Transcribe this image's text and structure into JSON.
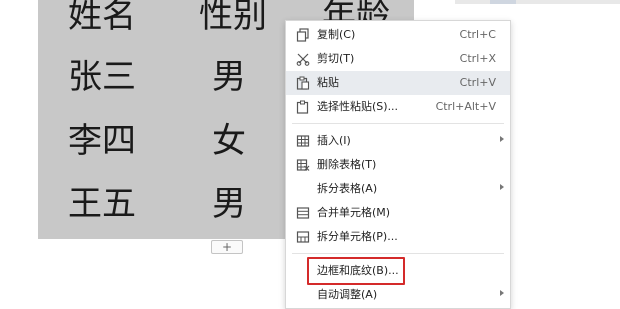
{
  "table": {
    "rows": [
      [
        "姓名",
        "性别",
        "年龄"
      ],
      [
        "张三",
        "男",
        ""
      ],
      [
        "李四",
        "女",
        ""
      ],
      [
        "王五",
        "男",
        ""
      ]
    ],
    "add_row_label": "+"
  },
  "context_menu": {
    "items": [
      {
        "label": "复制(C)",
        "shortcut": "Ctrl+C",
        "icon": "copy-icon"
      },
      {
        "label": "剪切(T)",
        "shortcut": "Ctrl+X",
        "icon": "scissors-icon"
      },
      {
        "label": "粘贴",
        "shortcut": "Ctrl+V",
        "icon": "paste-icon",
        "hovered": true
      },
      {
        "label": "选择性粘贴(S)...",
        "shortcut": "Ctrl+Alt+V",
        "icon": "paste-special-icon"
      },
      {
        "label": "插入(I)",
        "shortcut": "",
        "icon": "table-insert-icon",
        "submenu": true
      },
      {
        "label": "删除表格(T)",
        "shortcut": "",
        "icon": "table-delete-icon"
      },
      {
        "label": "拆分表格(A)",
        "shortcut": "",
        "icon": "",
        "submenu": true
      },
      {
        "label": "合并单元格(M)",
        "shortcut": "",
        "icon": "merge-cells-icon"
      },
      {
        "label": "拆分单元格(P)...",
        "shortcut": "",
        "icon": "split-cells-icon"
      },
      {
        "label": "边框和底纹(B)...",
        "shortcut": "",
        "icon": "",
        "highlighted": true
      },
      {
        "label": "自动调整(A)",
        "shortcut": "",
        "icon": "",
        "submenu": true
      }
    ]
  },
  "colors": {
    "table_bg": "#c8c8c8",
    "menu_hover": "#e8ebef",
    "highlight_border": "#d42a2a"
  }
}
